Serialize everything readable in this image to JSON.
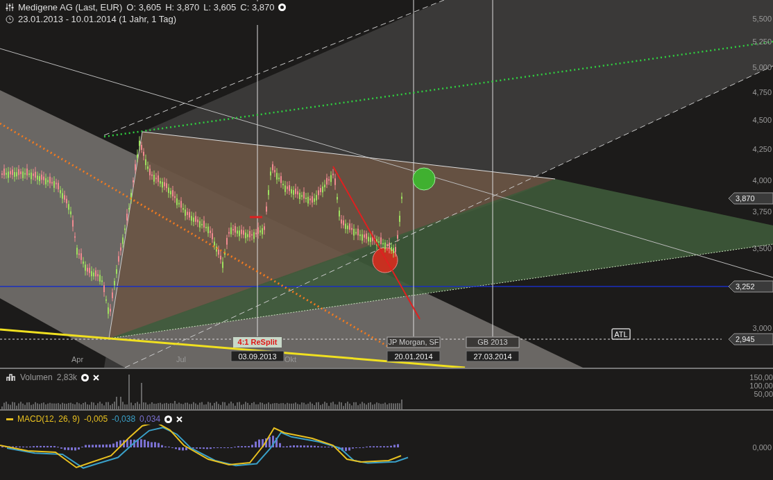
{
  "header": {
    "title": "Medigene AG (Last, EUR)",
    "quotes": [
      "O: 3,605",
      "H: 3,870",
      "L: 3,605",
      "C: 3,870"
    ],
    "range": "23.01.2013 - 10.01.2014 (1 Jahr, 1 Tag)"
  },
  "price_axis": {
    "ticks": [
      "5,500",
      "5,250",
      "5,000",
      "4,750",
      "4,500",
      "4,250",
      "4,000",
      "3,750",
      "3,500",
      "3,000"
    ],
    "tags": [
      "3,870",
      "3,252",
      "2,945"
    ]
  },
  "x_axis": [
    "Apr",
    "Jul",
    "Okt"
  ],
  "events": [
    {
      "kind": "split",
      "label": "4:1 ReSplit",
      "date": "03.09.2013"
    },
    {
      "kind": "note",
      "label": "JP Morgan, SF",
      "date": "20.01.2014"
    },
    {
      "kind": "note",
      "label": "GB 2013",
      "date": "27.03.2014"
    }
  ],
  "markers": [
    "ATL"
  ],
  "volume": {
    "title": "Volumen",
    "value": "2,83k",
    "ticks": [
      "150,00",
      "100,00",
      "50,00"
    ]
  },
  "macd": {
    "title": "MACD(12, 26, 9)",
    "values": [
      {
        "text": "-0,005",
        "color": "#e8c020"
      },
      {
        "text": "-0,038",
        "color": "#3aa0c8"
      },
      {
        "text": "0,034",
        "color": "#7a70d0"
      }
    ],
    "ticks": [
      "0,000"
    ]
  }
}
